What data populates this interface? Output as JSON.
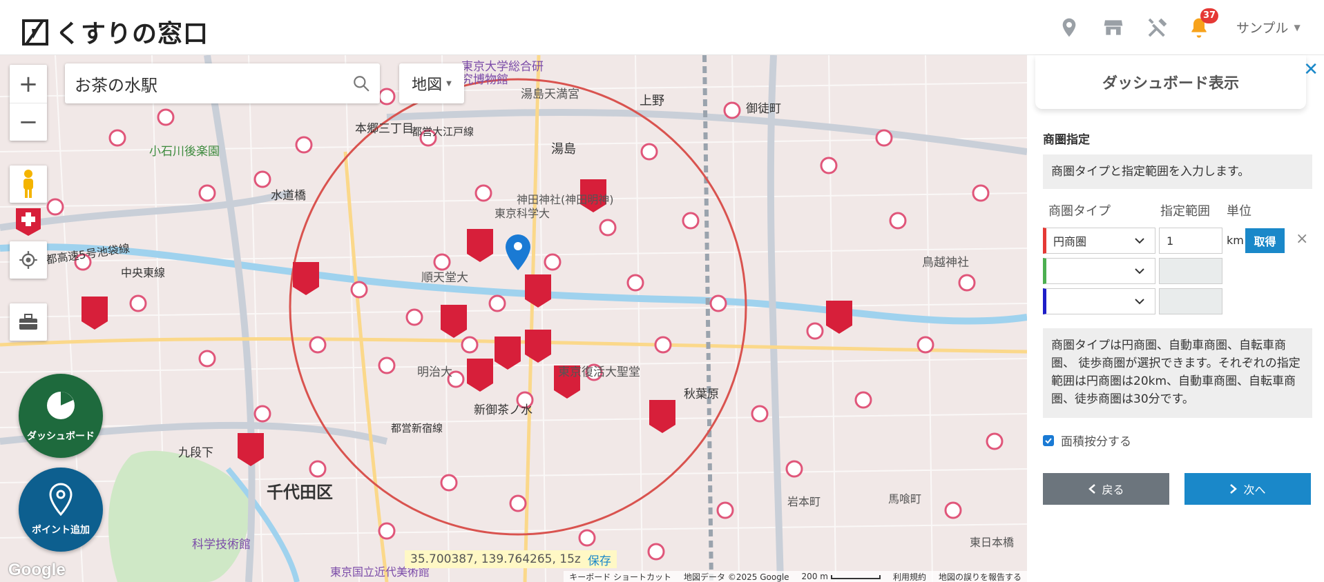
{
  "header": {
    "logo_text": "くすりの窓口",
    "notification_count": "37",
    "user_name": "サンプル",
    "icons": [
      "location-pin-icon",
      "store-icon",
      "tools-icon",
      "bell-icon"
    ]
  },
  "map": {
    "search_value": "お茶の水駅",
    "map_type_label": "地図",
    "coords_text": "35.700387, 139.764265, 15z",
    "save_label": "保存",
    "google_label": "Google",
    "attribution": {
      "keyboard": "キーボード ショートカット",
      "data": "地図データ ©2025 Google",
      "scale": "200 m",
      "terms": "利用規約",
      "report": "地図の誤りを報告する"
    },
    "fab_dashboard_label": "ダッシュボード",
    "fab_point_label": "ポイント追加",
    "labels": [
      {
        "text": "東京大学総合研究博物館",
        "kind": "poi"
      },
      {
        "text": "湯島天満宮",
        "kind": "place"
      },
      {
        "text": "上野",
        "kind": "place"
      },
      {
        "text": "御徒町",
        "kind": "place"
      },
      {
        "text": "本郷三丁目",
        "kind": "place"
      },
      {
        "text": "湯島",
        "kind": "place"
      },
      {
        "text": "小石川後楽園",
        "kind": "park"
      },
      {
        "text": "水道橋",
        "kind": "place"
      },
      {
        "text": "神田神社(神田明神)",
        "kind": "place"
      },
      {
        "text": "東京科学大",
        "kind": "place"
      },
      {
        "text": "順天堂大",
        "kind": "place"
      },
      {
        "text": "明治大",
        "kind": "place"
      },
      {
        "text": "東京復活大聖堂",
        "kind": "place"
      },
      {
        "text": "秋葉原",
        "kind": "place"
      },
      {
        "text": "新御茶ノ水",
        "kind": "place"
      },
      {
        "text": "九段下",
        "kind": "place"
      },
      {
        "text": "千代田区",
        "kind": "district"
      },
      {
        "text": "科学技術館",
        "kind": "place"
      },
      {
        "text": "鳥越神社",
        "kind": "place"
      },
      {
        "text": "岩本町",
        "kind": "place"
      },
      {
        "text": "馬喰町",
        "kind": "place"
      },
      {
        "text": "東日本橋",
        "kind": "place"
      },
      {
        "text": "首都高速5号池袋線",
        "kind": "road"
      },
      {
        "text": "中央東線",
        "kind": "road"
      },
      {
        "text": "都営大江戸線",
        "kind": "road"
      },
      {
        "text": "都営新宿線",
        "kind": "road"
      },
      {
        "text": "東京国立近代美術館",
        "kind": "poi"
      }
    ]
  },
  "panel": {
    "title": "ダッシュボード表示",
    "section_title": "商圏指定",
    "info_text": "商圏タイプと指定範囲を入力します。",
    "col_type": "商圏タイプ",
    "col_range": "指定範囲",
    "col_unit": "単位",
    "rows": [
      {
        "type": "円商圏",
        "range": "1",
        "unit": "km",
        "color": "#e53935"
      },
      {
        "type": "",
        "range": "",
        "unit": "",
        "color": "#4caf50"
      },
      {
        "type": "",
        "range": "",
        "unit": "",
        "color": "#1e1ec8"
      }
    ],
    "fetch_label": "取得",
    "info2_text": "商圏タイプは円商圏、自動車商圏、自転車商圏、 徒歩商圏が選択できます。それぞれの指定範囲は円商圏は20km、自動車商圏、自転車商圏、徒歩商圏は30分です。",
    "checkbox_label": "面積按分する",
    "back_label": "戻る",
    "next_label": "次へ"
  },
  "colors": {
    "accent": "#1a88c9",
    "dashboard_fab": "#1e6a3d",
    "point_fab": "#0d5f8f",
    "radius_circle": "#d9534f"
  }
}
